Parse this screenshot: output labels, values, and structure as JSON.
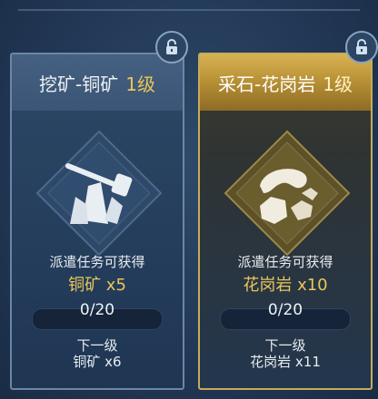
{
  "cards": [
    {
      "title": "挖矿-铜矿",
      "level": "1级",
      "dispatch_label": "派遣任务可获得",
      "reward": "铜矿 x5",
      "progress_text": "0/20",
      "progress_fraction": 0,
      "next_level_label": "下一级",
      "next_reward": "铜矿 x6",
      "emblem_icon": "pickaxe-crystal-icon",
      "lock_icon": "unlock-icon"
    },
    {
      "title": "采石-花岗岩",
      "level": "1级",
      "dispatch_label": "派遣任务可获得",
      "reward": "花岗岩 x10",
      "progress_text": "0/20",
      "progress_fraction": 0,
      "next_level_label": "下一级",
      "next_reward": "花岗岩 x11",
      "emblem_icon": "stone-hand-icon",
      "lock_icon": "unlock-icon"
    }
  ],
  "colors": {
    "gold": "#e9c65a",
    "panel_blue": "#2c4766",
    "header_gold": "#c9a54b"
  }
}
